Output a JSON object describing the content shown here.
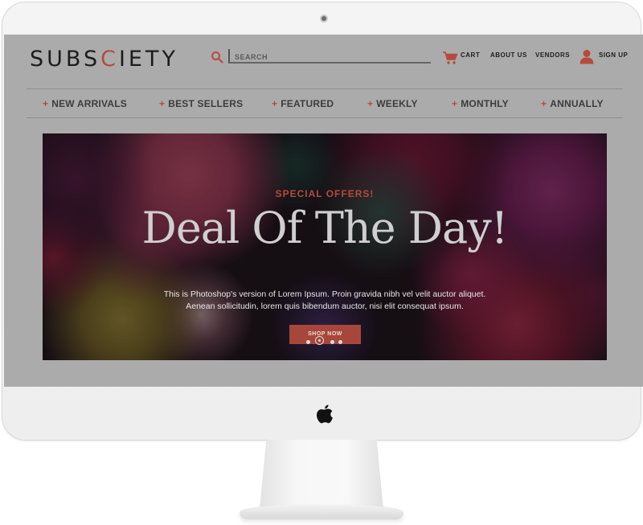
{
  "header": {
    "logo_left": "SUBS",
    "logo_accent": "C",
    "logo_right": "IETY",
    "search_placeholder": "SEARCH",
    "cart_label": "CART",
    "about_label": "ABOUT US",
    "vendors_label": "VENDORS",
    "signup_label": "SIGN UP"
  },
  "menu": {
    "items": [
      {
        "label": "NEW ARRIVALS"
      },
      {
        "label": "BEST SELLERS"
      },
      {
        "label": "FEATURED"
      },
      {
        "label": "WEEKLY"
      },
      {
        "label": "MONTHLY"
      },
      {
        "label": "ANNUALLY"
      }
    ],
    "plus": "+"
  },
  "hero": {
    "eyebrow": "SPECIAL OFFERS!",
    "title": "Deal Of The Day!",
    "body": "This is Photoshop's version  of Lorem Ipsum. Proin gravida nibh vel velit auctor aliquet. Aenean sollicitudin, lorem quis bibendum auctor, nisi elit consequat ipsum.",
    "button": "SHOP NOW",
    "slides_total": 4,
    "slide_active": 2
  },
  "colors": {
    "accent": "#b74a3c",
    "screen_bg": "#ababab",
    "button_bg": "#a7473b"
  },
  "icons": {
    "search": "search-icon",
    "cart": "cart-icon",
    "user": "user-icon",
    "brand": "apple-logo-icon"
  }
}
